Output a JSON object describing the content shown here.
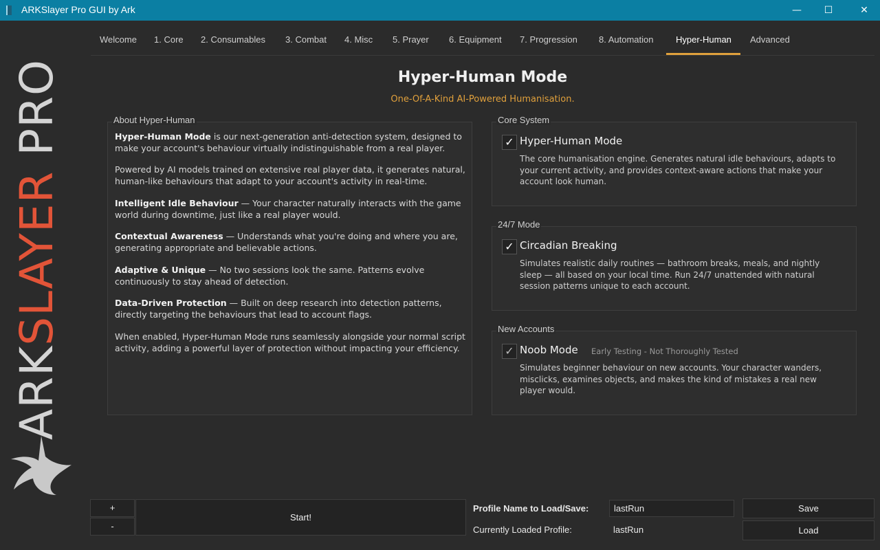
{
  "window": {
    "title": "ARKSlayer Pro GUI by Ark",
    "min_symbol": "—",
    "max_symbol": "☐",
    "close_symbol": "✕"
  },
  "sidebar": {
    "logo_prefix": "ARK",
    "logo_accent": "SLAYER",
    "logo_suffix": " PRO",
    "accent_color": "#e25438"
  },
  "tabs": [
    {
      "label": "Welcome"
    },
    {
      "label": "1. Core"
    },
    {
      "label": "2. Consumables"
    },
    {
      "label": "3. Combat"
    },
    {
      "label": "4. Misc"
    },
    {
      "label": "5. Prayer"
    },
    {
      "label": "6. Equipment"
    },
    {
      "label": "7. Progression"
    },
    {
      "label": "8. Automation"
    },
    {
      "label": "Hyper-Human"
    },
    {
      "label": "Advanced"
    }
  ],
  "active_tab": "Hyper-Human",
  "page": {
    "title": "Hyper-Human Mode",
    "subtitle": "One-Of-A-Kind AI-Powered Humanisation."
  },
  "about": {
    "heading": "About Hyper-Human",
    "p1_bold": "Hyper-Human Mode",
    "p1_text": " is our next-generation anti-detection system, designed to make your account's behaviour virtually indistinguishable from a real player.",
    "p2_text": "Powered by AI models trained on extensive real player data, it generates natural, human-like behaviours that adapt to your account's activity in real-time.",
    "p3_bold": "Intelligent Idle Behaviour",
    "p3_text": " — Your character naturally interacts with the game world during downtime, just like a real player would.",
    "p4_bold": "Contextual Awareness",
    "p4_text": " — Understands what you're doing and where you are, generating appropriate and believable actions.",
    "p5_bold": "Adaptive & Unique",
    "p5_text": " — No two sessions look the same. Patterns evolve continuously to stay ahead of detection.",
    "p6_bold": "Data-Driven Protection",
    "p6_text": " — Built on deep research into detection patterns, directly targeting the behaviours that lead to account flags.",
    "p7_text": "When enabled, Hyper-Human Mode runs seamlessly alongside your normal script activity, adding a powerful layer of protection without impacting your efficiency."
  },
  "core_system": {
    "heading": "Core System",
    "checkbox_label": "Hyper-Human Mode",
    "checked": true,
    "description": "The core humanisation engine. Generates natural idle behaviours, adapts to your current activity, and provides context-aware actions that make your account look human."
  },
  "mode_247": {
    "heading": "24/7 Mode",
    "checkbox_label": "Circadian Breaking",
    "checked": true,
    "description": "Simulates realistic daily routines — bathroom breaks, meals, and nightly sleep — all based on your local time. Run 24/7 unattended with natural session patterns unique to each account."
  },
  "new_accounts": {
    "heading": "New Accounts",
    "checkbox_label": "Noob Mode",
    "tag": "Early Testing - Not Thoroughly Tested",
    "checked": true,
    "description": "Simulates beginner behaviour on new accounts. Your character wanders, misclicks, examines objects, and makes the kind of mistakes a real new player would."
  },
  "footer": {
    "plus_label": "+",
    "minus_label": "-",
    "start_label": "Start!",
    "profile_name_label": "Profile Name to Load/Save:",
    "profile_name_value": "lastRun",
    "loaded_profile_label": "Currently Loaded Profile:",
    "loaded_profile_value": "lastRun",
    "save_label": "Save",
    "load_label": "Load"
  },
  "check_symbol": "✓"
}
